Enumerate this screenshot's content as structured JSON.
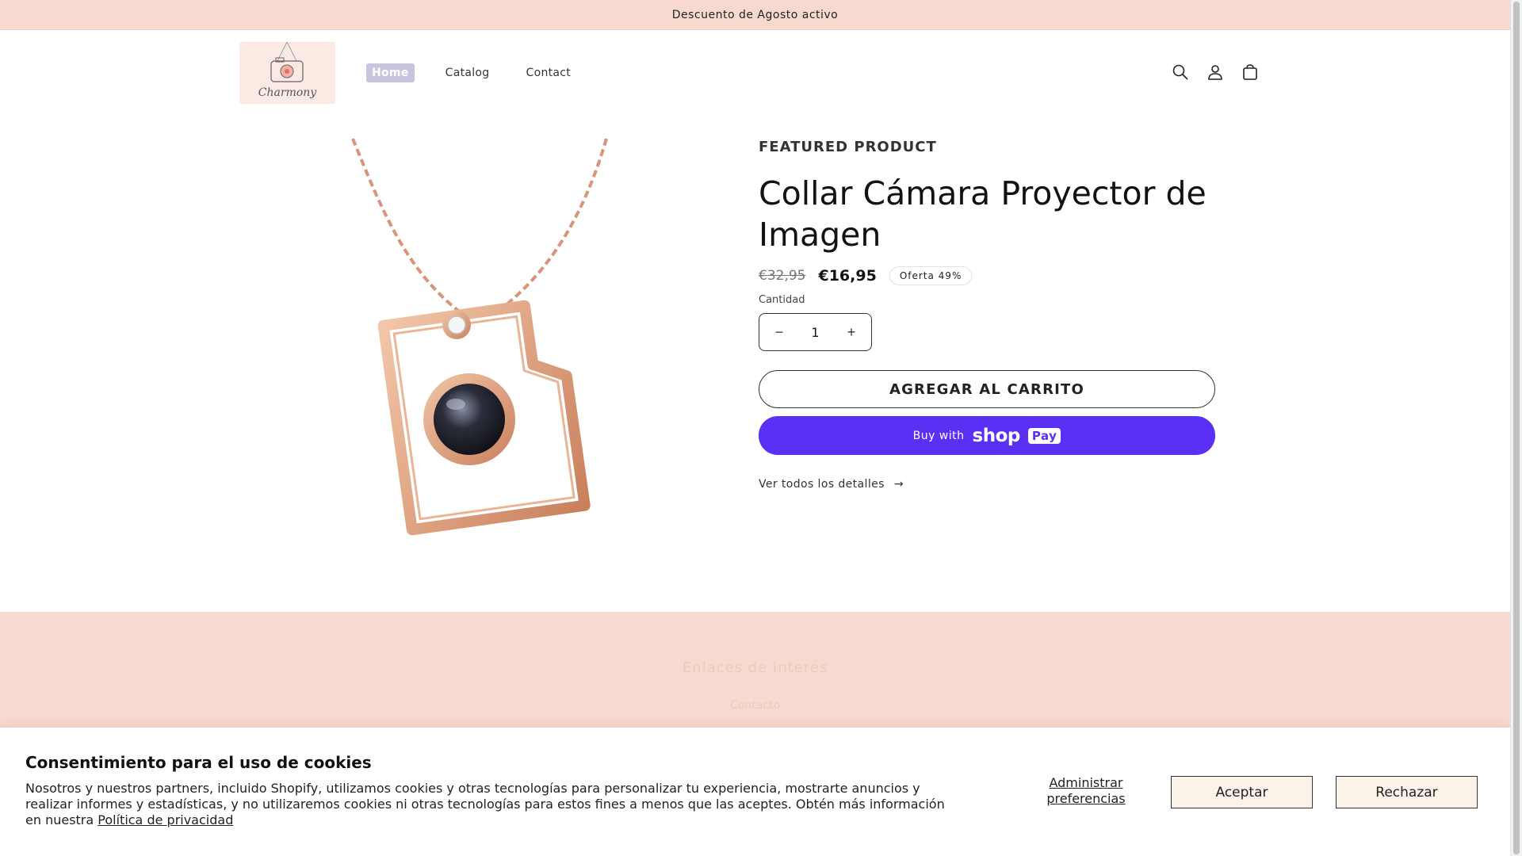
{
  "announcement": {
    "text": "Descuento de Agosto activo"
  },
  "header": {
    "logo_text": "Charmony",
    "nav": [
      {
        "label": "Home",
        "active": true
      },
      {
        "label": "Catalog",
        "active": false
      },
      {
        "label": "Contact",
        "active": false
      }
    ],
    "icons": [
      "search-icon",
      "account-icon",
      "cart-icon"
    ]
  },
  "product": {
    "featured_label": "FEATURED PRODUCT",
    "title": "Collar Cámara Proyector de Imagen",
    "old_price": "€32,95",
    "new_price": "€16,95",
    "sale_badge": "Oferta 49%",
    "quantity_label": "Cantidad",
    "quantity_value": "1",
    "minus": "−",
    "plus": "+",
    "add_to_cart": "AGREGAR AL CARRITO",
    "buy_with": "Buy with",
    "shop_brand": "shop",
    "shop_pay": "Pay",
    "details_link": "Ver todos los detalles",
    "details_arrow": "→"
  },
  "footer": {
    "title": "Enlaces de Interés",
    "link": "Contacto"
  },
  "cookie": {
    "title": "Consentimiento para el uso de cookies",
    "body": "Nosotros y nuestros partners, incluido Shopify, utilizamos cookies y otras tecnologías para personalizar tu experiencia, mostrarte anuncios y realizar informes y estadísticas, y no utilizaremos cookies ni otras tecnologías para estos fines a menos que las aceptes. Obtén más información en nuestra",
    "privacy_link": "Política de privacidad",
    "manage": "Administrar preferencias",
    "accept": "Aceptar",
    "reject": "Rechazar"
  },
  "colors": {
    "announcement_bg": "#f8d9cf",
    "shop_pay": "#5a31f4",
    "nav_active": "#c9c4de",
    "cookie_button_bg": "#fbf3e8"
  }
}
